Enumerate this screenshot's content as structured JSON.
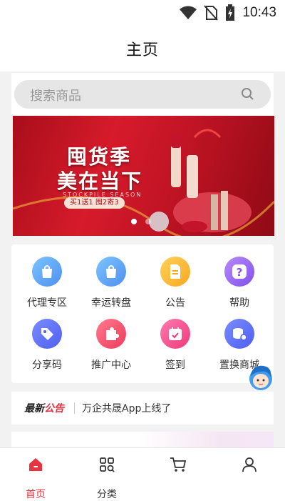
{
  "status_bar": {
    "time": "10:43"
  },
  "header": {
    "title": "主页"
  },
  "search": {
    "placeholder": "搜索商品"
  },
  "banner": {
    "line1": "囤货季",
    "line2": "美在当下",
    "subtitle": "STOCKPILE SEASON",
    "tag": "买1送1 囤2寄3",
    "dots": [
      true,
      false
    ]
  },
  "grid": {
    "items": [
      {
        "label": "代理专区",
        "icon": "bag-icon",
        "color": "#5aa7f5"
      },
      {
        "label": "幸运转盘",
        "icon": "bag-icon",
        "color": "#5aa7f5"
      },
      {
        "label": "公告",
        "icon": "document-icon",
        "color": "#f8b72e"
      },
      {
        "label": "帮助",
        "icon": "question-icon",
        "color": "#9a5cf0"
      },
      {
        "label": "分享码",
        "icon": "tag-icon",
        "color": "#5b6cf0"
      },
      {
        "label": "推广中心",
        "icon": "puzzle-icon",
        "color": "#f4456a"
      },
      {
        "label": "签到",
        "icon": "calendar-icon",
        "color": "#f24e8d"
      },
      {
        "label": "置换商城",
        "icon": "coins-icon",
        "color": "#5b6cf0"
      }
    ]
  },
  "notice": {
    "logo_part1": "最新",
    "logo_part2": "公告",
    "text": "万企共晟App上线了"
  },
  "tabbar": {
    "tabs": [
      {
        "label": "首页",
        "icon": "home-icon",
        "active": true
      },
      {
        "label": "分类",
        "icon": "category-icon",
        "active": false
      },
      {
        "label": "",
        "icon": "cart-icon",
        "active": false
      },
      {
        "label": "",
        "icon": "user-icon",
        "active": false
      }
    ],
    "active_color": "#e8343f"
  }
}
